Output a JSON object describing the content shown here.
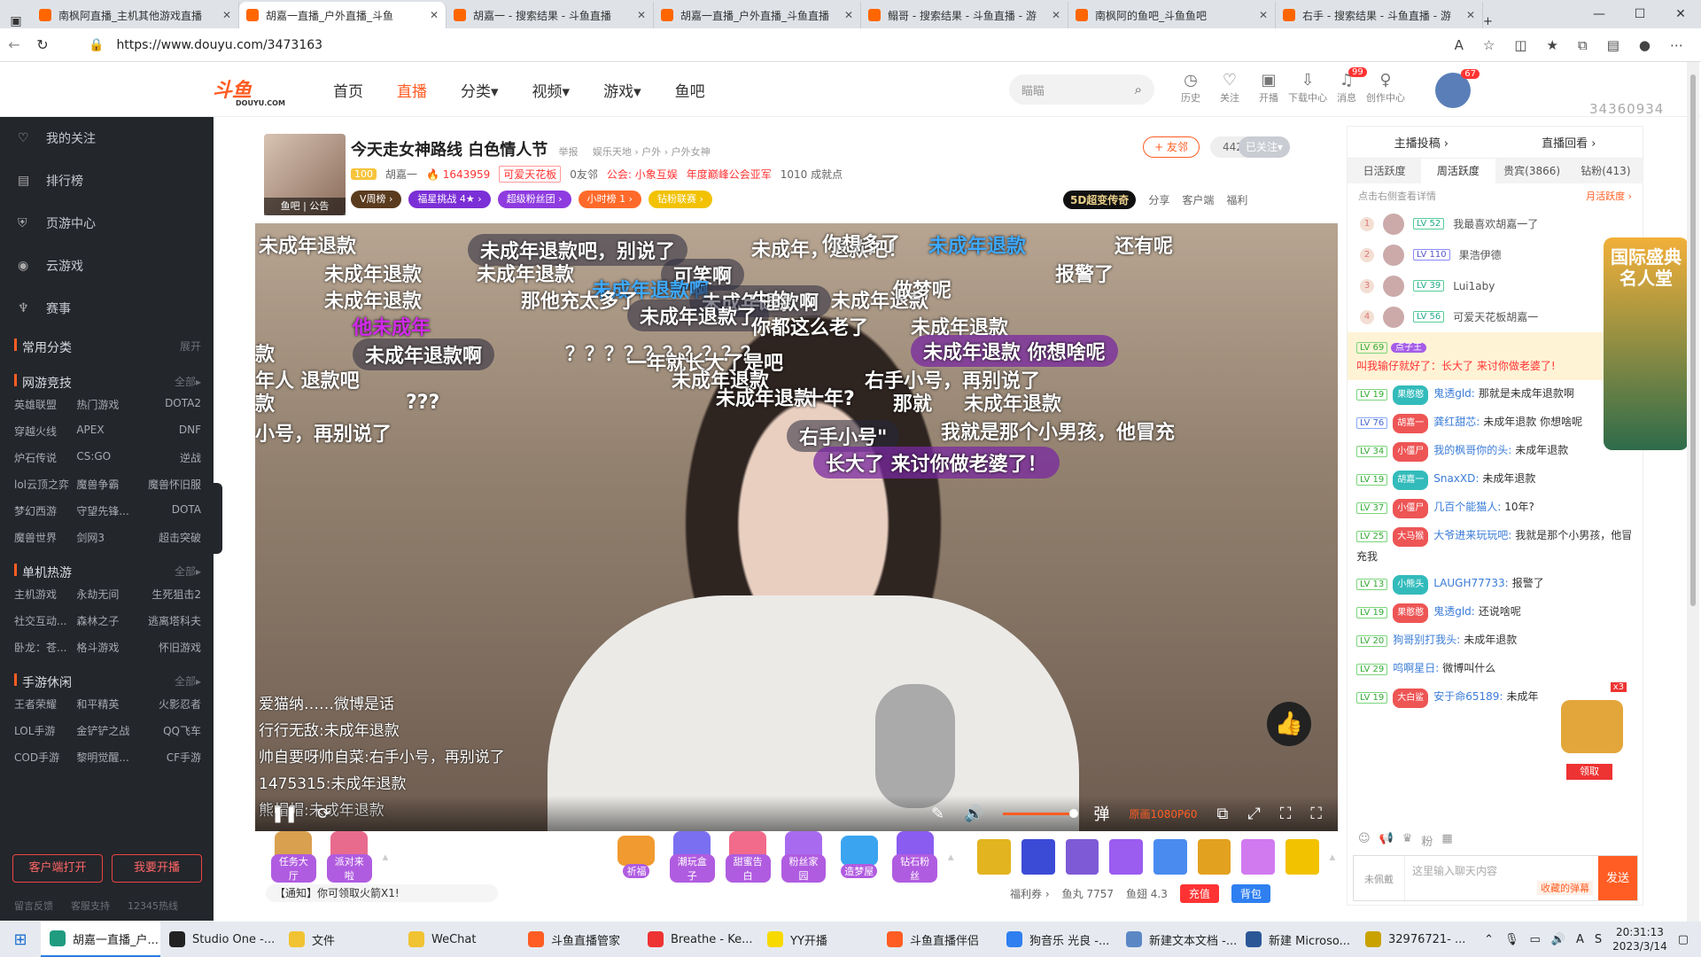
{
  "browser": {
    "tabs": [
      {
        "title": "南枫阿直播_主机其他游戏直播",
        "active": false
      },
      {
        "title": "胡嘉一直播_户外直播_斗鱼",
        "active": true
      },
      {
        "title": "胡嘉一 - 搜索结果 - 斗鱼直播",
        "active": false
      },
      {
        "title": "胡嘉一直播_户外直播_斗鱼直播",
        "active": false
      },
      {
        "title": "鳎哥 - 搜索结果 - 斗鱼直播 - 游",
        "active": false
      },
      {
        "title": "南枫阿的鱼吧_斗鱼鱼吧",
        "active": false
      },
      {
        "title": "右手 - 搜索结果 - 斗鱼直播 - 游",
        "active": false
      }
    ],
    "url": "https://www.douyu.com/3473163"
  },
  "header": {
    "logo_text": "斗鱼",
    "logo_sub": "DOUYU.COM",
    "nav": [
      "首页",
      "直播",
      "分类▾",
      "视频▾",
      "游戏▾",
      "鱼吧"
    ],
    "active_nav": "直播",
    "search_placeholder": "瞄瞄",
    "icons": [
      {
        "label": "历史",
        "icon": "clock-icon"
      },
      {
        "label": "关注",
        "icon": "heart-icon"
      },
      {
        "label": "开播",
        "icon": "camera-icon"
      },
      {
        "label": "下载中心",
        "icon": "download-icon"
      },
      {
        "label": "消息",
        "icon": "bell-icon",
        "badge": "99"
      },
      {
        "label": "创作中心",
        "icon": "bulb-icon"
      }
    ],
    "avatar_badge": "67",
    "user_id": "34360934"
  },
  "sidebar": {
    "top_items": [
      {
        "label": "我的关注",
        "icon": "heart-icon"
      },
      {
        "label": "排行榜",
        "icon": "rank-icon"
      },
      {
        "label": "页游中心",
        "icon": "shield-icon"
      },
      {
        "label": "云游戏",
        "icon": "gamepad-icon"
      },
      {
        "label": "赛事",
        "icon": "trophy-icon"
      }
    ],
    "common_title": "常用分类",
    "common_more": "展开",
    "sections": [
      {
        "title": "网游竞技",
        "more": "全部▸",
        "items": [
          "英雄联盟",
          "热门游戏",
          "DOTA2",
          "穿越火线",
          "APEX",
          "DNF",
          "炉石传说",
          "CS:GO",
          "逆战",
          "lol云顶之弈",
          "魔兽争霸",
          "魔兽怀旧服",
          "梦幻西游",
          "守望先锋...",
          "DOTA",
          "魔兽世界",
          "剑网3",
          "超击突破"
        ]
      },
      {
        "title": "单机热游",
        "more": "全部▸",
        "items": [
          "主机游戏",
          "永劫无间",
          "生死狙击2",
          "社交互动...",
          "森林之子",
          "逃离塔科夫",
          "卧龙：苍...",
          "格斗游戏",
          "怀旧游戏"
        ]
      },
      {
        "title": "手游休闲",
        "more": "全部▸",
        "items": [
          "王者荣耀",
          "和平精英",
          "火影忍者",
          "LOL手游",
          "金铲铲之战",
          "QQ飞车",
          "COD手游",
          "黎明觉醒...",
          "CF手游"
        ]
      }
    ],
    "btn_client": "客户端打开",
    "btn_stream": "我要开播",
    "footer": [
      "留言反馈",
      "客服支持",
      "12345热线"
    ]
  },
  "room": {
    "title": "今天走女神路线 白色情人节",
    "report": "举报",
    "category_path": "娱乐天地 › 户外 › 户外女神",
    "level": "100",
    "streamer": "胡嘉一",
    "hot": "1643959",
    "fan_badge": "可爱天花板",
    "friends": "0友邻",
    "guild": "公会: 小象互娱",
    "guild_rank": "年度巅峰公会亚军",
    "power": "1010 成就点",
    "cover_label": "鱼吧 | 公告",
    "tags": [
      "V周榜 ›",
      "福星挑战 4★ ›",
      "超级粉丝团 ›",
      "小时榜 1 ›",
      "钻粉联赛 ›"
    ],
    "follow_label": "+ 友邻",
    "follow_count": "442203",
    "followed_label": "已关注▾",
    "ad": "5D超变传奇",
    "actions": [
      "分享",
      "客户端",
      "福利"
    ]
  },
  "danmaku": [
    "未成年退款",
    "未成年退款吧，别说了",
    "未成年，退款吧！",
    "你想多了",
    "未成年退款",
    "还有呢",
    "未成年退款",
    "未成年退款",
    "可笑啊",
    "未成年退款啊",
    "报警了",
    "未成年退款",
    "那他充太多了",
    "未成年退款啊",
    "牛的",
    "未成年退款",
    "做梦呢",
    "他未成年",
    "未成年退款了",
    "你都这么老了",
    "未成年退款",
    "款",
    "未成年退款啊",
    "？？？？？？？？？？",
    "未成年退款 你想啥呢",
    "年人 退款吧",
    "一年就长大了是吧",
    "未成年退款",
    "右手小号，再别说了",
    "款",
    "???",
    "未成年退款",
    "十年?",
    "那就",
    "未成年退款",
    "小号，再别说了",
    "右手小号\"",
    "我就是那个小男孩，他冒充",
    "长大了 来讨你做老婆了！"
  ],
  "chat_overlay": [
    "爱猫纳……微博是话",
    "行行无敌:未成年退款",
    "帅自要呀帅自菜:右手小号，再别说了",
    "1475315:未成年退款",
    "熊帽帽:未成年退款"
  ],
  "player": {
    "quality": "原画1080P60"
  },
  "gifts": [
    {
      "label": "任务大厅"
    },
    {
      "label": "派对来啦"
    },
    {
      "label": "祈福"
    },
    {
      "label": "潮玩盒子"
    },
    {
      "label": "甜蜜告白"
    },
    {
      "label": "粉丝家园"
    },
    {
      "label": "造梦屋"
    },
    {
      "label": "钻石粉丝"
    }
  ],
  "notice": "【通知】你可领取火箭X1!",
  "bottom": {
    "welfare": "福利券 ›",
    "fish_ball": "鱼丸 7757",
    "fish_chi": "鱼翅 4.3",
    "recharge": "充值",
    "backpack": "背包"
  },
  "right_panel": {
    "top": [
      "主播投稿 ›",
      "直播回看 ›"
    ],
    "tabs": [
      "日活跃度",
      "周活跃度",
      "贵宾(3866)",
      "钻粉(413)"
    ],
    "active_tab": "周活跃度",
    "hint_left": "点击右侧查看详情",
    "hint_right": "月活跃度 ›",
    "ranks": [
      {
        "n": "1",
        "lv": "LV 52",
        "name": "我最喜欢胡嘉一了"
      },
      {
        "n": "2",
        "lv": "LV 110",
        "name": "果浩伊德"
      },
      {
        "n": "3",
        "lv": "LV 39",
        "name": "Lui1aby"
      },
      {
        "n": "4",
        "lv": "LV 56",
        "name": "可爱天花板胡嘉一"
      }
    ],
    "highlight": {
      "lv": "LV 69",
      "badge": "点子王",
      "line": "叫我输仔就好了：长大了 来讨你做老婆了!"
    },
    "messages": [
      {
        "lv": "LV 19",
        "fan": "果憨憨",
        "user": "鬼透gld:",
        "text": "那就是未成年退款啊"
      },
      {
        "lv": "LV 76",
        "fan": "胡嘉一",
        "user": "龚红甜芯:",
        "text": "未成年退款 你想啥呢"
      },
      {
        "lv": "LV 34",
        "fan": "小僵尸",
        "user": "我的枫哥你的头:",
        "text": "未成年退款"
      },
      {
        "lv": "LV 19",
        "fan": "胡嘉一",
        "user": "SnaxXD:",
        "text": "未成年退款"
      },
      {
        "lv": "LV 37",
        "fan": "小僵尸",
        "user": "几百个能猫人:",
        "text": "10年?"
      },
      {
        "lv": "LV 25",
        "fan": "大马猴",
        "user": "大爷进来玩玩吧:",
        "text": "我就是那个小男孩，他冒充我"
      },
      {
        "lv": "LV 13",
        "fan": "小熊头",
        "user": "LAUGH77733:",
        "text": "报警了"
      },
      {
        "lv": "LV 19",
        "fan": "果憨憨",
        "user": "鬼透gld:",
        "text": "还说啥呢"
      },
      {
        "lv": "LV 20",
        "fan": "",
        "user": "狗哥别打我头:",
        "text": "未成年退款"
      },
      {
        "lv": "LV 29",
        "fan": "",
        "user": "呜啊星日:",
        "text": "微博叫什么"
      },
      {
        "lv": "LV 19",
        "fan": "大白鲨",
        "user": "安于命65189:",
        "text": "未成年"
      }
    ],
    "chest_count": "x3",
    "claim": "领取",
    "promo_line1": "国际盛典",
    "promo_line2": "名人堂",
    "input_placeholder": "这里输入聊天内容",
    "input_badge": "收藏的弹幕",
    "emoji_label": "未佩戴",
    "send": "发送"
  },
  "taskbar": {
    "items": [
      {
        "label": "胡嘉一直播_户...",
        "color": "#1f9b7f",
        "active": true
      },
      {
        "label": "Studio One -...",
        "color": "#222",
        "active": false
      },
      {
        "label": "文件",
        "color": "#f1c232",
        "active": false
      },
      {
        "label": "WeChat",
        "color": "#f1c232",
        "active": false
      },
      {
        "label": "斗鱼直播管家",
        "color": "#ff5d23",
        "active": false
      },
      {
        "label": "Breathe - Ke...",
        "color": "#e33",
        "active": false
      },
      {
        "label": "YY开播",
        "color": "#f7d900",
        "active": false
      },
      {
        "label": "斗鱼直播伴侣",
        "color": "#ff5d23",
        "active": false
      },
      {
        "label": "狗音乐 光良 -...",
        "color": "#2f7ff0",
        "active": false
      },
      {
        "label": "新建文本文档 -...",
        "color": "#5b88c5",
        "active": false
      },
      {
        "label": "新建 Microso...",
        "color": "#2b5797",
        "active": false
      },
      {
        "label": "32976721- ...",
        "color": "#c9a200",
        "active": false
      }
    ],
    "time": "20:31:13",
    "date": "2023/3/14"
  }
}
